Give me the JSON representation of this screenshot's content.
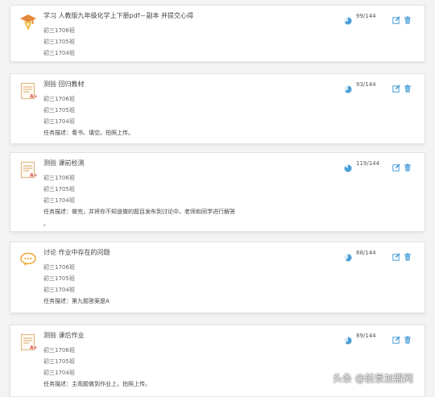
{
  "colors": {
    "accent": "#4a9fd8",
    "icon_orange": "#e58a3c",
    "icon_red": "#d9534f",
    "icon_yellow": "#f2c14e"
  },
  "tasks": [
    {
      "icon": "study-icon",
      "title": "学习 人教版九年级化学上下册pdf－副本 并提交心得",
      "count": "99/144",
      "progress": 0.69,
      "classes": [
        "初三1706班",
        "初三1705班",
        "初三1704班"
      ],
      "desc": "",
      "desc2": ""
    },
    {
      "icon": "test-icon",
      "title": "测验 回归教材",
      "count": "93/144",
      "progress": 0.65,
      "classes": [
        "初三1706班",
        "初三1705班",
        "初三1704班"
      ],
      "desc": "任务描述：看书、填空。拍照上传。",
      "desc2": ""
    },
    {
      "icon": "test-icon",
      "title": "测验 课前检测",
      "count": "119/144",
      "progress": 0.83,
      "classes": [
        "初三1706班",
        "初三1705班",
        "初三1704班"
      ],
      "desc": "任务描述：做完，并将你不知道做的题目发布到讨论中，老师和同学进行解答",
      "desc2": "。"
    },
    {
      "icon": "discuss-icon",
      "title": "讨论 作业中存在的问题",
      "count": "88/144",
      "progress": 0.61,
      "classes": [
        "初三1706班",
        "初三1705班",
        "初三1704班"
      ],
      "desc": "任务描述：第九题答案是A",
      "desc2": ""
    },
    {
      "icon": "test-icon",
      "title": "测验 课后作业",
      "count": "89/144",
      "progress": 0.62,
      "classes": [
        "初三1706班",
        "初三1705班",
        "初三1704班"
      ],
      "desc": "任务描述：主观题做到作业上，拍照上传。",
      "desc2": ""
    }
  ],
  "watermark": "头条 @前景加盟网"
}
